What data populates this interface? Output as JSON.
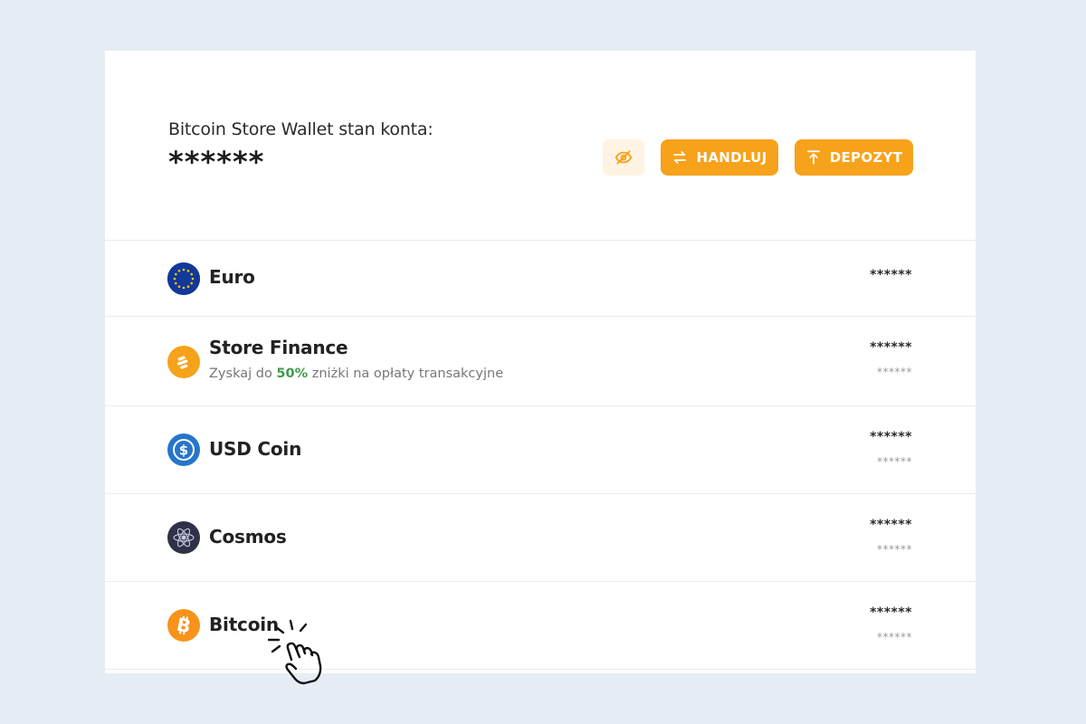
{
  "header": {
    "balance_label": "Bitcoin Store Wallet stan konta:",
    "balance_value": "******",
    "hide_icon": "eye-off-icon",
    "trade_label": "HANDLUJ",
    "deposit_label": "DEPOZYT"
  },
  "colors": {
    "accent": "#f7a21b",
    "accent_soft": "#fff4e3",
    "page_bg": "#e6edf4",
    "positive": "#3f9c4a"
  },
  "assets": [
    {
      "name": "Euro",
      "icon": "euro-flag-icon",
      "amount": "******"
    },
    {
      "name": "Store Finance",
      "icon": "store-finance-icon",
      "sub_prefix": "Zyskaj do ",
      "sub_highlight": "50%",
      "sub_suffix": " zniżki na opłaty transakcyjne",
      "amount": "******",
      "amount_secondary": "******"
    },
    {
      "name": "USD Coin",
      "icon": "usd-coin-icon",
      "amount": "******",
      "amount_secondary": "******"
    },
    {
      "name": "Cosmos",
      "icon": "cosmos-icon",
      "amount": "******",
      "amount_secondary": "******"
    },
    {
      "name": "Bitcoin",
      "icon": "bitcoin-icon",
      "amount": "******",
      "amount_secondary": "******"
    }
  ],
  "cursor": {
    "icon": "hand-pointer-click-icon"
  }
}
